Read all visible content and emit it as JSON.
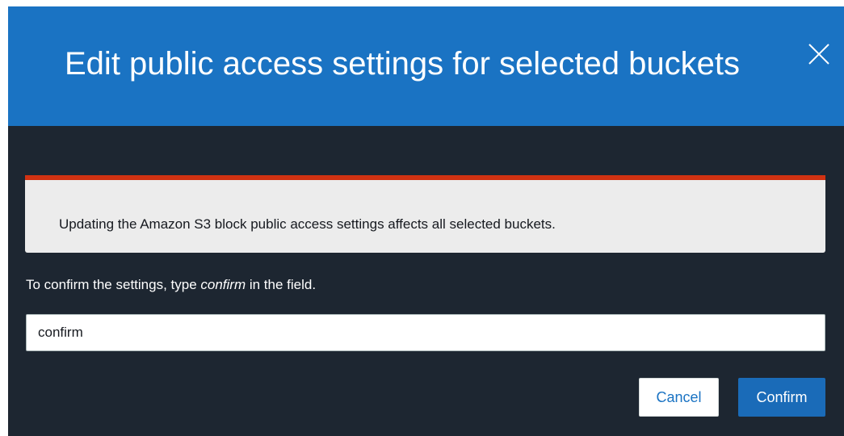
{
  "modal": {
    "title": "Edit public access settings for selected buckets",
    "close_icon": "close-icon"
  },
  "alert": {
    "message": "Updating the Amazon S3 block public access settings affects all selected buckets.",
    "color": "#d13212"
  },
  "instruction": {
    "before": "To confirm the settings, type ",
    "keyword": "confirm",
    "after": " in the field."
  },
  "confirm_field": {
    "value": "confirm"
  },
  "buttons": {
    "cancel_label": "Cancel",
    "confirm_label": "Confirm"
  },
  "colors": {
    "header": "#1a73c3",
    "body": "#1d2631",
    "primary_button": "#1a6bb8"
  }
}
